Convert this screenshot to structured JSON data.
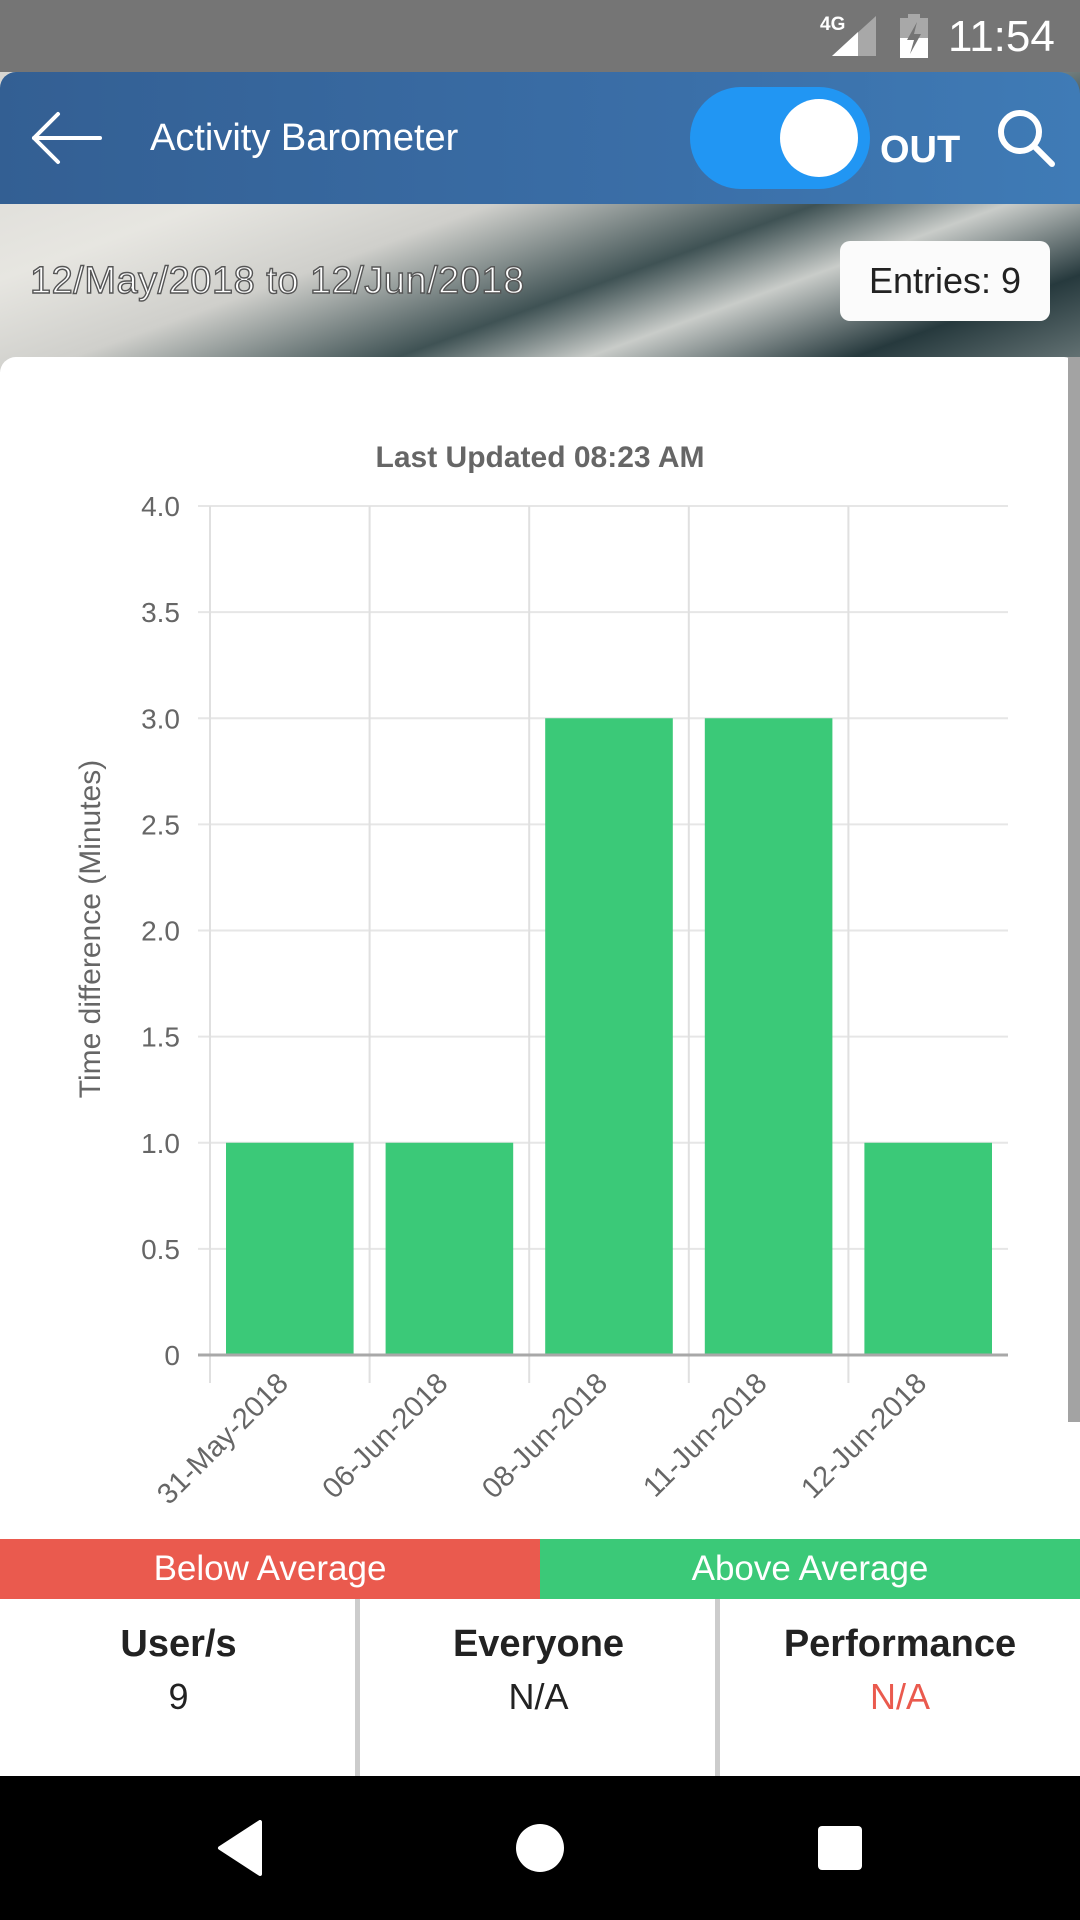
{
  "status_bar": {
    "network": "4G",
    "time": "11:54",
    "icons": [
      "signal-icon",
      "battery-charging-icon"
    ]
  },
  "header": {
    "back_icon": "arrow-left-icon",
    "title": "Activity Barometer",
    "toggle_label": "OUT",
    "toggle_on": true,
    "search_icon": "search-icon",
    "toggle_color": "#2196f3"
  },
  "date_band": {
    "range": "12/May/2018 to 12/Jun/2018",
    "entries_label": "Entries: 9"
  },
  "chart_data": {
    "type": "bar",
    "title": "Last Updated 08:23 AM",
    "xlabel": "",
    "ylabel": "Time difference (Minutes)",
    "categories": [
      "31-May-2018",
      "06-Jun-2018",
      "08-Jun-2018",
      "11-Jun-2018",
      "12-Jun-2018"
    ],
    "values": [
      1,
      1,
      3,
      3,
      1
    ],
    "ylim": [
      0,
      4
    ],
    "yticks": [
      0,
      0.5,
      1.0,
      1.5,
      2.0,
      2.5,
      3.0,
      3.5,
      4.0
    ],
    "ytick_labels": [
      "0",
      "0.5",
      "1.0",
      "1.5",
      "2.0",
      "2.5",
      "3.0",
      "3.5",
      "4.0"
    ],
    "grid": true,
    "bar_color": "#3bc978",
    "x_label_rotation": "-45deg"
  },
  "legend": {
    "below_label": "Below Average",
    "above_label": "Above Average",
    "below_color": "#ea5a4e",
    "above_color": "#3bc978"
  },
  "stats": [
    {
      "title": "User/s",
      "value": "9",
      "value_color": "#222222"
    },
    {
      "title": "Everyone",
      "value": "N/A",
      "value_color": "#222222"
    },
    {
      "title": "Performance",
      "value": "N/A",
      "value_color": "#ea5a4e"
    }
  ],
  "nav_bar": {
    "icons": [
      "nav-back-icon",
      "nav-home-icon",
      "nav-recents-icon"
    ]
  }
}
